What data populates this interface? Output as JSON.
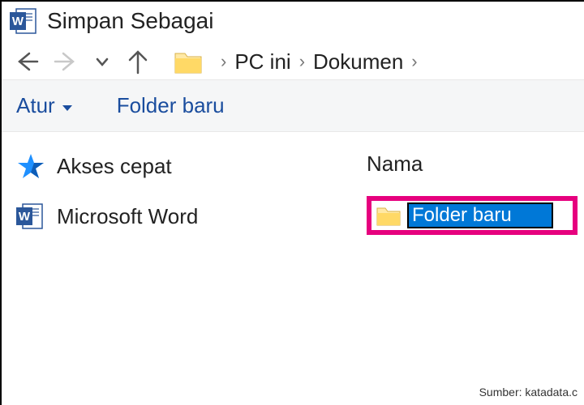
{
  "window": {
    "title": "Simpan Sebagai"
  },
  "breadcrumb": {
    "items": [
      "PC ini",
      "Dokumen"
    ]
  },
  "toolbar": {
    "organize_label": "Atur",
    "new_folder_label": "Folder baru"
  },
  "sidebar": {
    "items": [
      {
        "label": "Akses cepat"
      },
      {
        "label": "Microsoft Word"
      }
    ]
  },
  "main": {
    "column_header": "Nama",
    "editing_folder_name": "Folder baru"
  },
  "attribution": "Sumber: katadata.c"
}
